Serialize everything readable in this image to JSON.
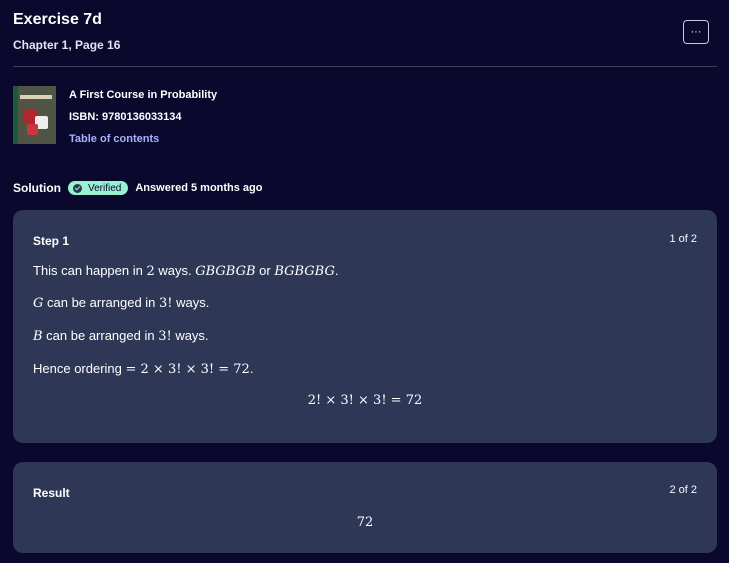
{
  "header": {
    "title": "Exercise 7d",
    "subtitle": "Chapter 1, Page 16",
    "more_label": "···"
  },
  "book": {
    "title": "A First Course in Probability",
    "isbn": "ISBN: 9780136033134",
    "toc_link": "Table of contents"
  },
  "solution": {
    "label": "Solution",
    "verified_badge": "Verified",
    "answered": "Answered 5 months ago"
  },
  "step1": {
    "title": "Step 1",
    "counter": "1 of 2",
    "line1_text": "This can happen in ",
    "line1_num": "2",
    "line1_mid": " ways. ",
    "line1_seq1": "GBGBGB",
    "line1_or": " or ",
    "line1_seq2": "BGBGBG",
    "line1_end": ".",
    "line2_var": "G",
    "line2_text": " can be arranged in ",
    "line2_num": "3!",
    "line2_end": " ways.",
    "line3_var": "B",
    "line3_text": " can be arranged in ",
    "line3_num": "3!",
    "line3_end": " ways.",
    "line4_text": "Hence ordering ",
    "line4_math": "= 2 × 3! × 3! = 72",
    "line4_end": ".",
    "equation": "2! × 3! × 3! = 72"
  },
  "result": {
    "title": "Result",
    "counter": "2 of 2",
    "value": "72"
  },
  "colors": {
    "background": "#0a092d",
    "card": "#2e3856",
    "verified_badge": "#98f1d1",
    "link": "#a8b1ff"
  }
}
